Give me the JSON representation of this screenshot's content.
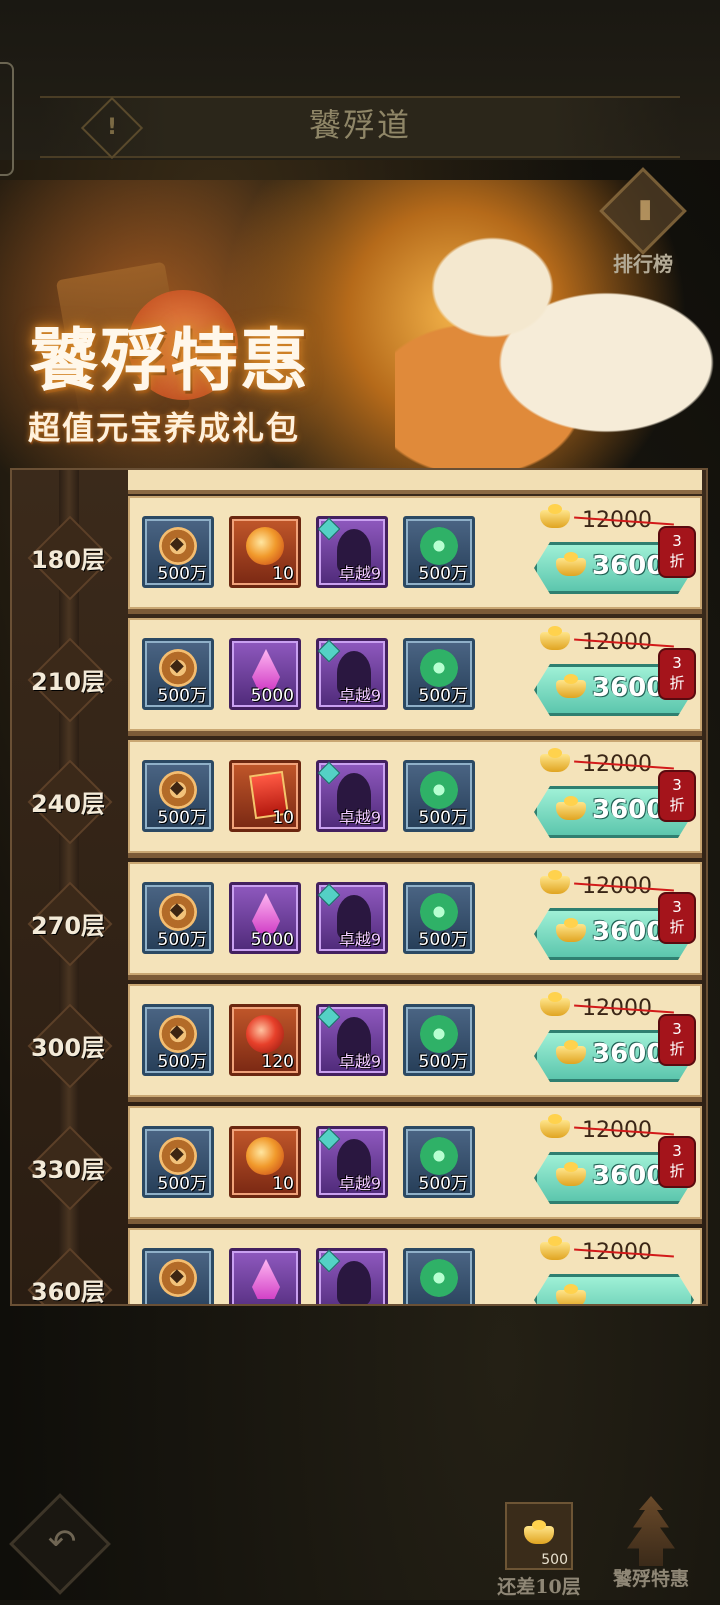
{
  "header": {
    "title": "饕殍道",
    "info_icon": "!"
  },
  "ranking": {
    "label": "排行榜",
    "icon": "bar-chart-icon"
  },
  "banner": {
    "title": "饕殍特惠",
    "subtitle": "超值元宝养成礼包"
  },
  "colors": {
    "discount_badge": "#a4141b",
    "buy_button": "#5cc6ad",
    "panel_row": "#f4e3ba"
  },
  "rows": [
    {
      "floor": "180层",
      "items": [
        {
          "icon": "copper-coin-icon",
          "qty": "500万",
          "frame": "blue"
        },
        {
          "icon": "fire-orb-icon",
          "qty": "10",
          "frame": "red"
        },
        {
          "icon": "hero-silhouette-icon",
          "qty": "卓越9",
          "frame": "purple"
        },
        {
          "icon": "jade-orb-icon",
          "qty": "500万",
          "frame": "blue"
        }
      ],
      "original_price": "12000",
      "price": "3600",
      "discount": "3折"
    },
    {
      "floor": "210层",
      "items": [
        {
          "icon": "copper-coin-icon",
          "qty": "500万",
          "frame": "blue"
        },
        {
          "icon": "purple-crystal-icon",
          "qty": "5000",
          "frame": "purple"
        },
        {
          "icon": "hero-silhouette-icon",
          "qty": "卓越9",
          "frame": "purple"
        },
        {
          "icon": "jade-orb-icon",
          "qty": "500万",
          "frame": "blue"
        }
      ],
      "original_price": "12000",
      "price": "3600",
      "discount": "3折"
    },
    {
      "floor": "240层",
      "items": [
        {
          "icon": "copper-coin-icon",
          "qty": "500万",
          "frame": "blue"
        },
        {
          "icon": "red-card-icon",
          "qty": "10",
          "frame": "red"
        },
        {
          "icon": "hero-silhouette-icon",
          "qty": "卓越9",
          "frame": "purple"
        },
        {
          "icon": "jade-orb-icon",
          "qty": "500万",
          "frame": "blue"
        }
      ],
      "original_price": "12000",
      "price": "3600",
      "discount": "3折"
    },
    {
      "floor": "270层",
      "items": [
        {
          "icon": "copper-coin-icon",
          "qty": "500万",
          "frame": "blue"
        },
        {
          "icon": "purple-crystal-icon",
          "qty": "5000",
          "frame": "purple"
        },
        {
          "icon": "hero-silhouette-icon",
          "qty": "卓越9",
          "frame": "purple"
        },
        {
          "icon": "jade-orb-icon",
          "qty": "500万",
          "frame": "blue"
        }
      ],
      "original_price": "12000",
      "price": "3600",
      "discount": "3折"
    },
    {
      "floor": "300层",
      "items": [
        {
          "icon": "copper-coin-icon",
          "qty": "500万",
          "frame": "blue"
        },
        {
          "icon": "red-orb-icon",
          "qty": "120",
          "frame": "red"
        },
        {
          "icon": "hero-silhouette-icon",
          "qty": "卓越9",
          "frame": "purple"
        },
        {
          "icon": "jade-orb-icon",
          "qty": "500万",
          "frame": "blue"
        }
      ],
      "original_price": "12000",
      "price": "3600",
      "discount": "3折"
    },
    {
      "floor": "330层",
      "items": [
        {
          "icon": "copper-coin-icon",
          "qty": "500万",
          "frame": "blue"
        },
        {
          "icon": "fire-orb-icon",
          "qty": "10",
          "frame": "red"
        },
        {
          "icon": "hero-silhouette-icon",
          "qty": "卓越9",
          "frame": "purple"
        },
        {
          "icon": "jade-orb-icon",
          "qty": "500万",
          "frame": "blue"
        }
      ],
      "original_price": "12000",
      "price": "3600",
      "discount": "3折"
    },
    {
      "floor": "360层",
      "items": [
        {
          "icon": "copper-coin-icon",
          "qty": "",
          "frame": "blue"
        },
        {
          "icon": "purple-crystal-icon",
          "qty": "",
          "frame": "purple"
        },
        {
          "icon": "hero-silhouette-icon",
          "qty": "",
          "frame": "purple"
        },
        {
          "icon": "jade-orb-icon",
          "qty": "",
          "frame": "blue"
        }
      ],
      "original_price": "12000",
      "price": "",
      "discount": ""
    }
  ],
  "bottom": {
    "back_icon": "back-arrow-icon",
    "floors_left_count": "500",
    "floors_left_label": "还差10层",
    "special_label": "饕殍特惠"
  }
}
